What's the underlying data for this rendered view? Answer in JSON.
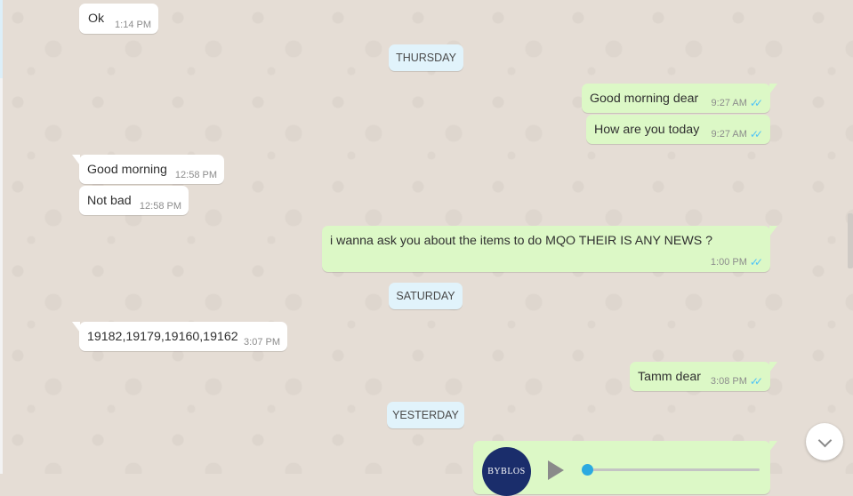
{
  "messages": [
    {
      "text": "Ok",
      "time": "1:14 PM"
    },
    {
      "text": "Good morning dear",
      "time": "9:27 AM"
    },
    {
      "text": "How are you today",
      "time": "9:27 AM"
    },
    {
      "text": "Good morning",
      "time": "12:58 PM"
    },
    {
      "text": "Not bad",
      "time": "12:58 PM"
    },
    {
      "text": "i wanna ask you about the items to do MQO THEIR IS ANY NEWS ?",
      "time": "1:00 PM"
    },
    {
      "text": "19182,19179,19160,19162",
      "time": "3:07 PM"
    },
    {
      "text": "Tamm dear",
      "time": "3:08 PM"
    }
  ],
  "day_dividers": [
    "THURSDAY",
    "SATURDAY",
    "YESTERDAY"
  ],
  "voice_note": {
    "avatar_text": "BYBLOS",
    "progress": 0.0
  },
  "icons": {
    "read_receipt": "double-check-icon",
    "play": "play-icon",
    "scroll": "chevron-down-icon"
  },
  "colors": {
    "incoming": "#ffffff",
    "outgoing": "#dcf8c6",
    "day_badge": "#e1f3fb",
    "read_tick": "#4fc3f7",
    "wallpaper": "#e5ddd5"
  }
}
